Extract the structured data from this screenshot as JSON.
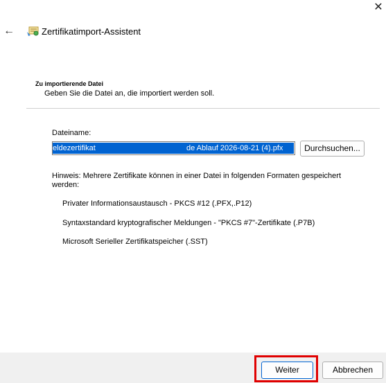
{
  "window": {
    "title": "Zertifikatimport-Assistent",
    "close_icon": "close-icon",
    "back_icon": "back-arrow-icon",
    "app_icon": "certificate-icon"
  },
  "section": {
    "heading": "Zu importierende Datei",
    "description": "Geben Sie die Datei an, die importiert werden soll."
  },
  "file": {
    "label": "Dateiname:",
    "value_part1": "eldezertifikat",
    "value_part2": "de Ablauf 2026-08-21 (4).pfx",
    "browse_label": "Durchsuchen..."
  },
  "hint": {
    "text": "Hinweis: Mehrere Zertifikate können in einer Datei in folgenden Formaten gespeichert werden:",
    "formats": [
      "Privater Informationsaustausch - PKCS #12 (.PFX,.P12)",
      "Syntaxstandard kryptografischer Meldungen - \"PKCS #7\"-Zertifikate (.P7B)",
      "Microsoft Serieller Zertifikatspeicher (.SST)"
    ]
  },
  "footer": {
    "next_label": "Weiter",
    "cancel_label": "Abbrechen",
    "highlight_color": "#e00000"
  }
}
